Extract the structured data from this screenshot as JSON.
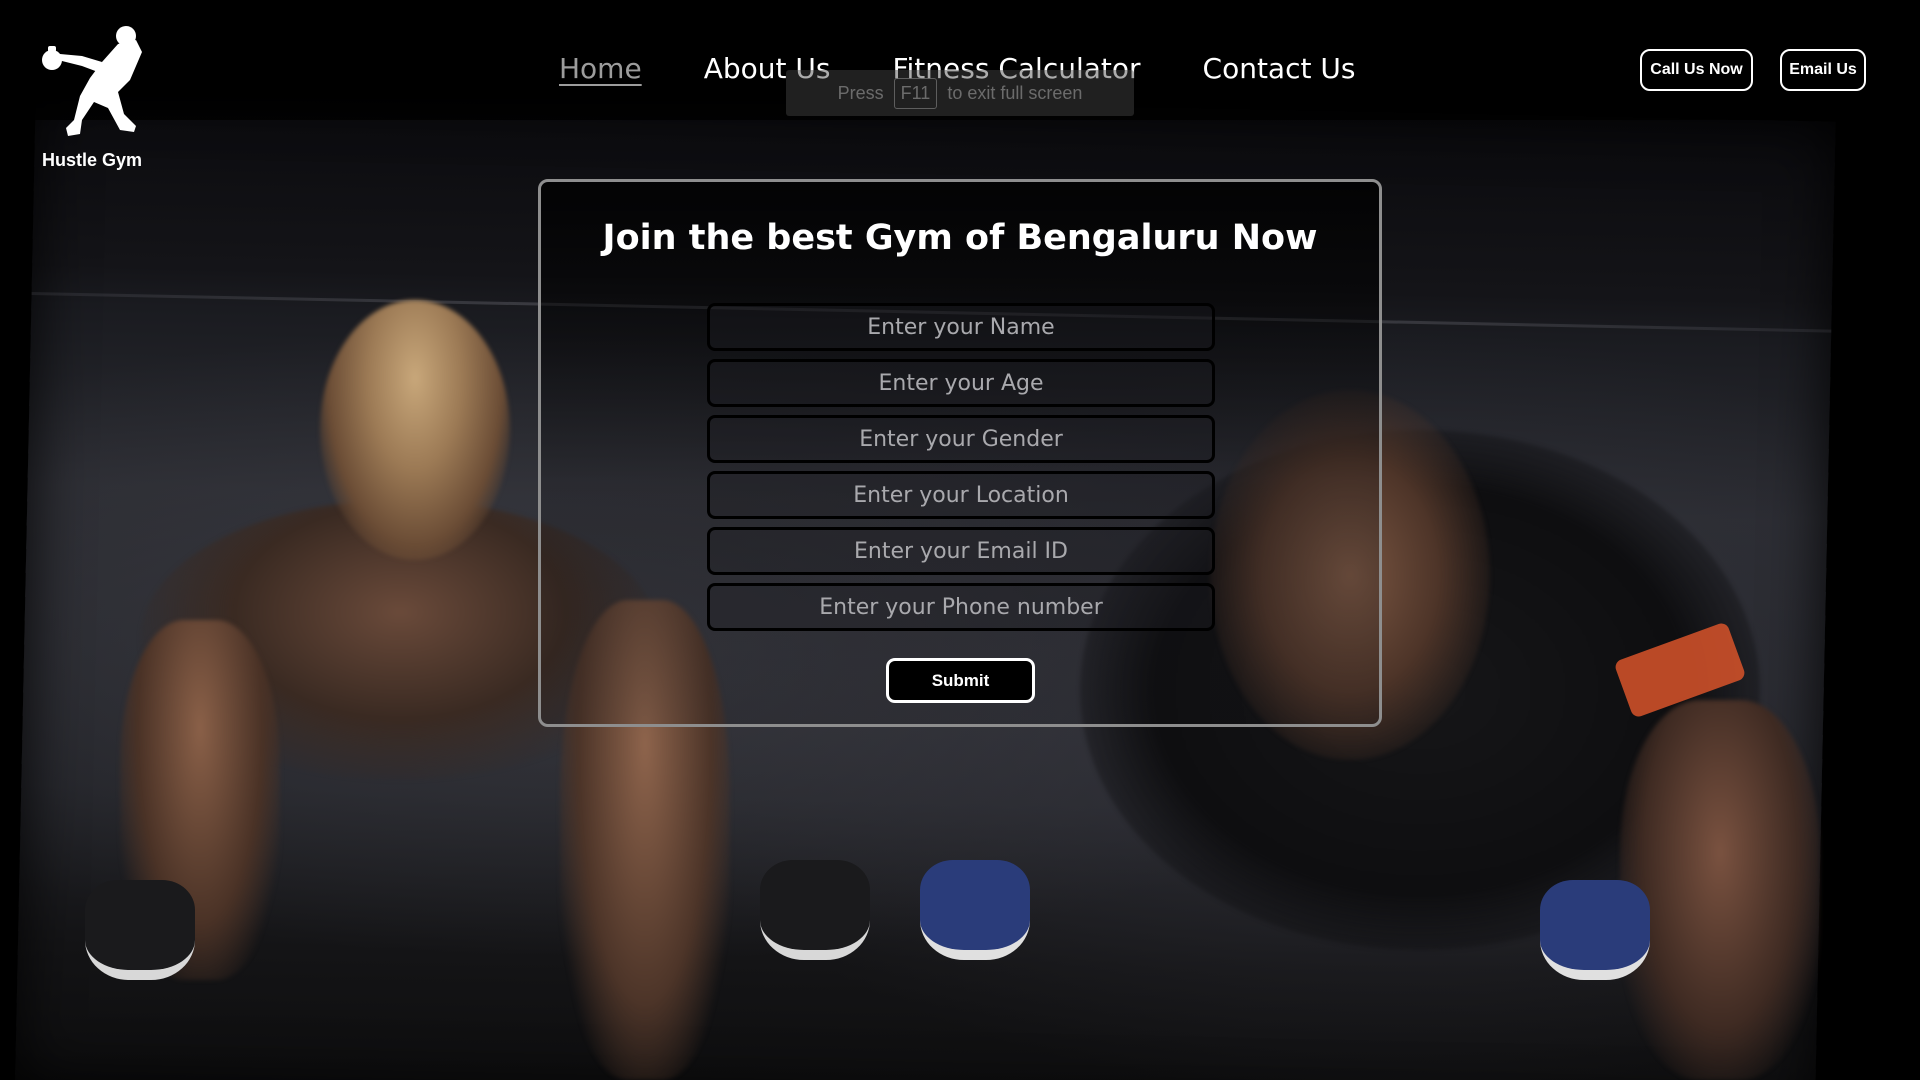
{
  "brand": {
    "name": "Hustle Gym",
    "logo_icon": "kettlebell-athlete-icon"
  },
  "nav": {
    "items": [
      {
        "label": "Home",
        "active": true
      },
      {
        "label": "About Us",
        "active": false
      },
      {
        "label": "Fitness Calculator",
        "active": false
      },
      {
        "label": "Contact Us",
        "active": false
      }
    ]
  },
  "header_buttons": {
    "call_label": "Call Us Now",
    "email_label": "Email Us"
  },
  "fullscreen_hint": {
    "press": "Press",
    "key": "F11",
    "rest": "to exit full screen"
  },
  "form": {
    "title": "Join the best Gym of Bengaluru Now",
    "fields": [
      {
        "placeholder": "Enter your Name",
        "value": ""
      },
      {
        "placeholder": "Enter your Age",
        "value": ""
      },
      {
        "placeholder": "Enter your Gender",
        "value": ""
      },
      {
        "placeholder": "Enter your Location",
        "value": ""
      },
      {
        "placeholder": "Enter your Email ID",
        "value": ""
      },
      {
        "placeholder": "Enter your Phone number",
        "value": ""
      }
    ],
    "submit_label": "Submit"
  },
  "colors": {
    "background": "#000000",
    "text": "#ffffff",
    "nav_active": "#9c9c9c",
    "card_border": "#8e8e8e",
    "accent_band": "#d8532a"
  }
}
